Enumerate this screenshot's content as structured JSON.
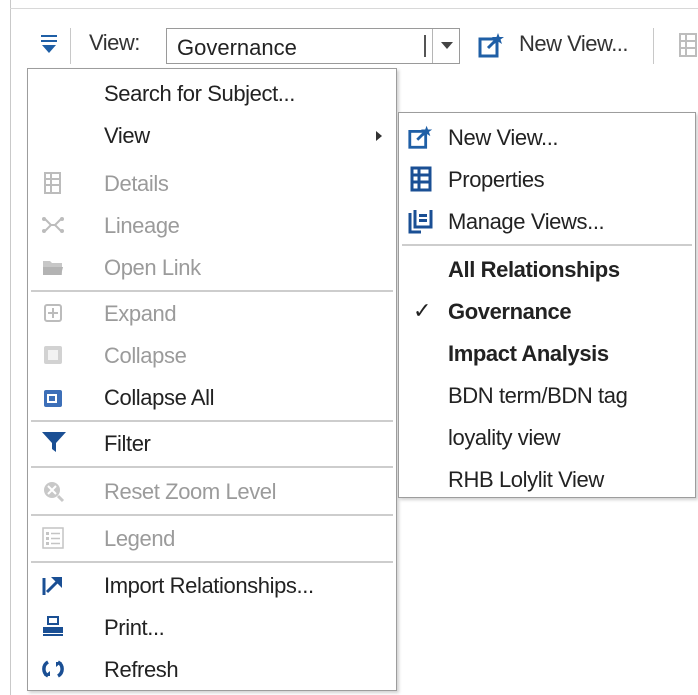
{
  "toolbar": {
    "view_label": "View:",
    "view_value": "Governance",
    "new_view_label": "New View..."
  },
  "main_menu": {
    "search": "Search for Subject...",
    "view": "View",
    "details": "Details",
    "lineage": "Lineage",
    "open_link": "Open Link",
    "expand": "Expand",
    "collapse": "Collapse",
    "collapse_all": "Collapse All",
    "filter": "Filter",
    "reset_zoom": "Reset Zoom Level",
    "legend": "Legend",
    "import_relationships": "Import Relationships...",
    "print": "Print...",
    "refresh": "Refresh"
  },
  "view_submenu": {
    "new_view": "New View...",
    "properties": "Properties",
    "manage_views": "Manage Views...",
    "views": [
      {
        "label": "All Relationships",
        "bold": true,
        "checked": false
      },
      {
        "label": "Governance",
        "bold": true,
        "checked": true
      },
      {
        "label": "Impact Analysis",
        "bold": true,
        "checked": false
      },
      {
        "label": "BDN term/BDN tag",
        "bold": false,
        "checked": false
      },
      {
        "label": "loyality view",
        "bold": false,
        "checked": false
      },
      {
        "label": "RHB Lolylit View",
        "bold": false,
        "checked": false
      }
    ],
    "check_mark": "✓"
  },
  "colors": {
    "icon_blue": "#1f5fa6",
    "disabled_text": "#9b9b9b",
    "menu_border": "#9d9d9d"
  }
}
